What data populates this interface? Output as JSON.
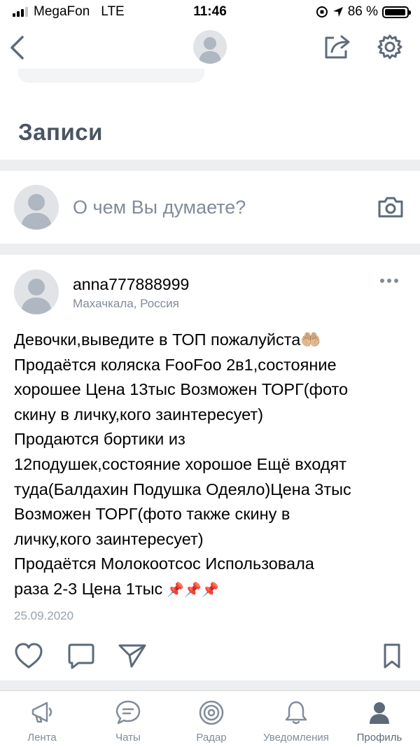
{
  "status_bar": {
    "carrier": "MegaFon",
    "network": "LTE",
    "time": "11:46",
    "battery_percent": "86 %",
    "battery_level": 0.86
  },
  "nav": {
    "back_icon": "chevron-left-icon",
    "share_icon": "share-icon",
    "settings_icon": "gear-icon"
  },
  "section": {
    "title": "Записи"
  },
  "composer": {
    "placeholder": "О чем Вы думаете?",
    "camera_icon": "camera-icon"
  },
  "post": {
    "author": "anna777888999",
    "location": "Махачкала, Россия",
    "lines": [
      "Девочки,выведите в ТОП пожалуйста🤲🏼",
      "Продаётся коляска FooFoo 2в1,состояние",
      "хорошее Цена 13тыс Возможен ТОРГ(фото",
      "скину в личку,кого заинтересует)",
      "Продаются бортики из",
      "12подушек,состояние хорошое Ещё входят",
      "туда(Балдахин Подушка Одеяло)Цена 3тыс",
      "Возможен ТОРГ(фото также скину в",
      "личку,кого заинтересует)",
      "Продаётся Молокоотсос  Использовала",
      "раза 2-3 Цена 1тыс"
    ],
    "pins": "📌📌📌",
    "date": "25.09.2020"
  },
  "tabbar": {
    "items": [
      {
        "label": "Лента",
        "icon": "megaphone-icon"
      },
      {
        "label": "Чаты",
        "icon": "chat-bubble-icon"
      },
      {
        "label": "Радар",
        "icon": "radar-icon"
      },
      {
        "label": "Уведомления",
        "icon": "bell-icon"
      },
      {
        "label": "Профиль",
        "icon": "profile-icon"
      }
    ],
    "active": "Профиль"
  },
  "colors": {
    "secondary_text": "#818c99",
    "title_text": "#4a5462",
    "separator": "#edeef0",
    "avatar_placeholder": "#e1e3e6"
  }
}
